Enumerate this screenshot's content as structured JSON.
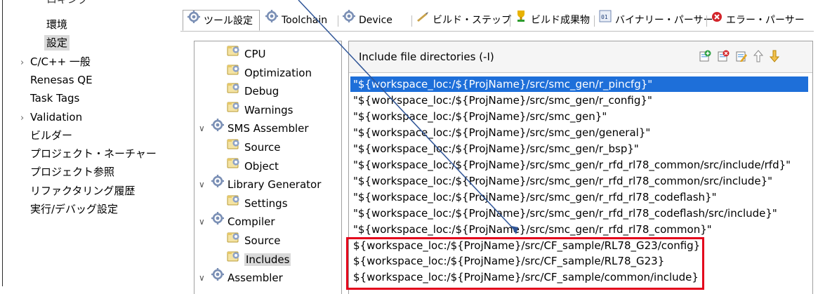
{
  "nav": {
    "partial_top": "ロギング",
    "items": [
      {
        "label": "環境",
        "indent": 2,
        "selected": false,
        "expandable": false
      },
      {
        "label": "設定",
        "indent": 2,
        "selected": true,
        "expandable": false
      },
      {
        "label": "C/C++ 一般",
        "indent": 0,
        "selected": false,
        "expandable": true
      },
      {
        "label": "Renesas QE",
        "indent": 1,
        "selected": false,
        "expandable": false
      },
      {
        "label": "Task Tags",
        "indent": 1,
        "selected": false,
        "expandable": false
      },
      {
        "label": "Validation",
        "indent": 0,
        "selected": false,
        "expandable": true
      },
      {
        "label": "ビルダー",
        "indent": 1,
        "selected": false,
        "expandable": false
      },
      {
        "label": "プロジェクト・ネーチャー",
        "indent": 1,
        "selected": false,
        "expandable": false
      },
      {
        "label": "プロジェクト参照",
        "indent": 1,
        "selected": false,
        "expandable": false
      },
      {
        "label": "リファクタリング履歴",
        "indent": 1,
        "selected": false,
        "expandable": false
      },
      {
        "label": "実行/デバッグ設定",
        "indent": 1,
        "selected": false,
        "expandable": false
      }
    ]
  },
  "tabs": [
    {
      "label": "ツール設定",
      "icon": "settings-gear-icon",
      "active": true
    },
    {
      "label": "Toolchain",
      "icon": "settings-gear-icon",
      "active": false
    },
    {
      "label": "Device",
      "icon": "settings-gear-icon",
      "active": false
    },
    {
      "label": "ビルド・ステップ",
      "icon": "build-steps-icon",
      "active": false
    },
    {
      "label": "ビルド成果物",
      "icon": "trophy-icon",
      "active": false
    },
    {
      "label": "バイナリー・パーサー",
      "icon": "binary-parser-icon",
      "active": false
    },
    {
      "label": "エラー・パーサー",
      "icon": "error-icon",
      "active": false
    }
  ],
  "tool_tree": {
    "items": [
      {
        "label": "CPU",
        "icon": "tool-option-icon",
        "level": 1,
        "expanded": null,
        "selected": false
      },
      {
        "label": "Optimization",
        "icon": "tool-option-icon",
        "level": 1,
        "expanded": null,
        "selected": false
      },
      {
        "label": "Debug",
        "icon": "tool-option-icon",
        "level": 1,
        "expanded": null,
        "selected": false
      },
      {
        "label": "Warnings",
        "icon": "tool-option-icon",
        "level": 1,
        "expanded": null,
        "selected": false
      },
      {
        "label": "SMS Assembler",
        "icon": "settings-gear-icon",
        "level": 0,
        "expanded": true,
        "selected": false
      },
      {
        "label": "Source",
        "icon": "tool-option-icon",
        "level": 1,
        "expanded": null,
        "selected": false
      },
      {
        "label": "Object",
        "icon": "tool-option-icon",
        "level": 1,
        "expanded": null,
        "selected": false
      },
      {
        "label": "Library Generator",
        "icon": "settings-gear-icon",
        "level": 0,
        "expanded": true,
        "selected": false
      },
      {
        "label": "Settings",
        "icon": "tool-option-icon",
        "level": 1,
        "expanded": null,
        "selected": false
      },
      {
        "label": "Compiler",
        "icon": "settings-gear-icon",
        "level": 0,
        "expanded": true,
        "selected": false
      },
      {
        "label": "Source",
        "icon": "tool-option-icon",
        "level": 1,
        "expanded": null,
        "selected": false
      },
      {
        "label": "Includes",
        "icon": "tool-option-icon",
        "level": 1,
        "expanded": null,
        "selected": true
      },
      {
        "label": "Assembler",
        "icon": "settings-gear-icon",
        "level": 0,
        "expanded": true,
        "selected": false
      }
    ]
  },
  "include_panel": {
    "title": "Include file directories (-I)",
    "toolbar": [
      {
        "name": "add-directory-button",
        "icon": "add-icon"
      },
      {
        "name": "delete-directory-button",
        "icon": "delete-icon"
      },
      {
        "name": "edit-directory-button",
        "icon": "edit-icon"
      },
      {
        "name": "move-up-button",
        "icon": "arrow-up-icon"
      },
      {
        "name": "move-down-button",
        "icon": "arrow-down-icon"
      }
    ],
    "rows": [
      {
        "text": "\"${workspace_loc:/${ProjName}/src/smc_gen/r_pincfg}\"",
        "selected": true
      },
      {
        "text": "\"${workspace_loc:/${ProjName}/src/smc_gen/r_config}\"",
        "selected": false
      },
      {
        "text": "\"${workspace_loc:/${ProjName}/src/smc_gen}\"",
        "selected": false
      },
      {
        "text": "\"${workspace_loc:/${ProjName}/src/smc_gen/general}\"",
        "selected": false
      },
      {
        "text": "\"${workspace_loc:/${ProjName}/src/smc_gen/r_bsp}\"",
        "selected": false
      },
      {
        "text": "\"${workspace_loc:/${ProjName}/src/smc_gen/r_rfd_rl78_common/src/include/rfd}\"",
        "selected": false
      },
      {
        "text": "\"${workspace_loc:/${ProjName}/src/smc_gen/r_rfd_rl78_common/src/include}\"",
        "selected": false
      },
      {
        "text": "\"${workspace_loc:/${ProjName}/src/smc_gen/r_rfd_rl78_codeflash}\"",
        "selected": false
      },
      {
        "text": "\"${workspace_loc:/${ProjName}/src/smc_gen/r_rfd_rl78_codeflash/src/include}\"",
        "selected": false
      },
      {
        "text": "\"${workspace_loc:/${ProjName}/src/smc_gen/r_rfd_rl78_common}\"",
        "selected": false
      },
      {
        "text": "${workspace_loc:/${ProjName}/src/CF_sample/RL78_G23/config}",
        "selected": false
      },
      {
        "text": "${workspace_loc:/${ProjName}/src/CF_sample/RL78_G23}",
        "selected": false
      },
      {
        "text": "${workspace_loc:/${ProjName}/src/CF_sample/common/include}",
        "selected": false
      }
    ]
  },
  "annotation": {
    "highlight_color": "#e3001b",
    "arrow_color": "#2f5597"
  },
  "colors": {
    "selection_blue": "#1e6fd9",
    "selection_gray": "#d9d9d9"
  }
}
